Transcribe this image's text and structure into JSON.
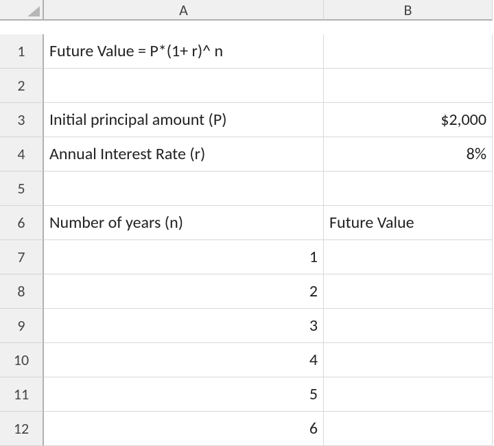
{
  "columns": [
    "A",
    "B"
  ],
  "rowNumbers": [
    "1",
    "2",
    "3",
    "4",
    "5",
    "6",
    "7",
    "8",
    "9",
    "10",
    "11",
    "12"
  ],
  "cells": {
    "A1": "Future Value = P*(1+ r)^ n",
    "A3": "Initial principal amount (P)",
    "B3": "$2,000",
    "A4": "Annual Interest Rate (r)",
    "B4": "8%",
    "A6": "Number of years (n)",
    "B6": "Future Value",
    "A7": "1",
    "A8": "2",
    "A9": "3",
    "A10": "4",
    "A11": "5",
    "A12": "6"
  },
  "chart_data": {
    "type": "table",
    "title": "Future Value = P*(1+ r)^ n",
    "parameters": {
      "P_initial_principal": 2000,
      "r_annual_interest_rate": 0.08
    },
    "columns": [
      "Number of years (n)",
      "Future Value"
    ],
    "rows": [
      [
        1,
        null
      ],
      [
        2,
        null
      ],
      [
        3,
        null
      ],
      [
        4,
        null
      ],
      [
        5,
        null
      ],
      [
        6,
        null
      ]
    ]
  }
}
